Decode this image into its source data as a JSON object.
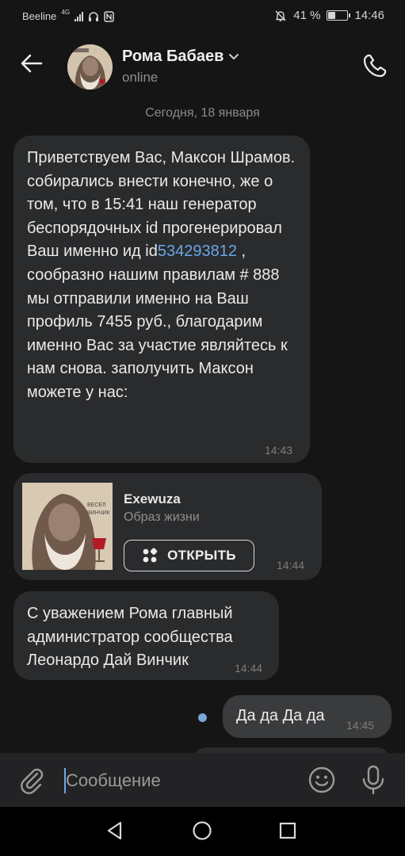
{
  "statusbar": {
    "carrier": "Beeline",
    "network": "4G",
    "battery": "41 %",
    "battery_level": 0.41,
    "time": "14:46"
  },
  "header": {
    "name": "Рома Бабаев",
    "status": "online"
  },
  "date_separator": "Сегодня, 18 января",
  "messages": [
    {
      "text_before_link": "Приветствуем Вас, Максон Шрамов. собирались внести конечно, же о том, что в 15:41 наш генератор беспорядочных id прогенерировал Ваш именно ид id",
      "link": "534293812",
      "text_after_link": " , сообразно нашим правилам # 888 мы отправили именно на Ваш профиль  7455 руб., благодарим именно Вас за участие являйтесь к нам снова. заполучить Максон можете у нас:",
      "time": "14:43"
    },
    {
      "card_title": "Exewuza",
      "card_subtitle": "Образ жизни",
      "button_label": "ОТКРЫТЬ",
      "time": "14:44"
    },
    {
      "text": "С уважением Рома главный администратор сообщества Леонардо Дай Винчик",
      "time": "14:44"
    },
    {
      "text": "Да да Да да",
      "time": "14:45"
    }
  ],
  "composer": {
    "placeholder": "Сообщение"
  },
  "colors": {
    "background": "#151515",
    "bubble_incoming": "#2a2b2d",
    "bubble_outgoing": "#3a3b3d",
    "link": "#6aa7e6",
    "unread_dot": "#7aa6d8"
  },
  "icons": [
    "back-arrow-icon",
    "chevron-down-icon",
    "phone-icon",
    "apps-icon",
    "attach-icon",
    "emoji-icon",
    "microphone-icon",
    "nav-back-icon",
    "nav-home-icon",
    "nav-recent-icon"
  ]
}
